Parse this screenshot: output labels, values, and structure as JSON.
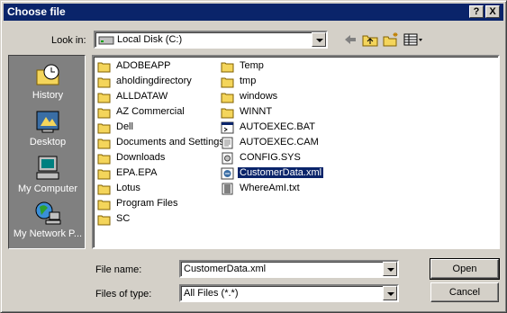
{
  "dialog": {
    "title": "Choose file",
    "help_label": "?",
    "close_label": "X"
  },
  "toolbar": {
    "look_in_label": "Look in:",
    "look_in_value": "Local Disk (C:)",
    "tools": [
      "back-arrow-icon",
      "up-folder-icon",
      "new-folder-icon",
      "view-menu-icon"
    ]
  },
  "places": [
    {
      "label": "History",
      "icon": "history-icon"
    },
    {
      "label": "Desktop",
      "icon": "desktop-icon"
    },
    {
      "label": "My Computer",
      "icon": "my-computer-icon"
    },
    {
      "label": "My Network P...",
      "icon": "network-icon"
    }
  ],
  "files": [
    {
      "name": "ADOBEAPP",
      "type": "folder"
    },
    {
      "name": "aholdingdirectory",
      "type": "folder"
    },
    {
      "name": "ALLDATAW",
      "type": "folder"
    },
    {
      "name": "AZ Commercial",
      "type": "folder"
    },
    {
      "name": "Dell",
      "type": "folder"
    },
    {
      "name": "Documents and Settings",
      "type": "folder"
    },
    {
      "name": "Downloads",
      "type": "folder"
    },
    {
      "name": "EPA.EPA",
      "type": "folder"
    },
    {
      "name": "Lotus",
      "type": "folder"
    },
    {
      "name": "Program Files",
      "type": "folder"
    },
    {
      "name": "SC",
      "type": "folder"
    },
    {
      "name": "Temp",
      "type": "folder"
    },
    {
      "name": "tmp",
      "type": "folder"
    },
    {
      "name": "windows",
      "type": "folder"
    },
    {
      "name": "WINNT",
      "type": "folder"
    },
    {
      "name": "AUTOEXEC.BAT",
      "type": "bat"
    },
    {
      "name": "AUTOEXEC.CAM",
      "type": "doc"
    },
    {
      "name": "CONFIG.SYS",
      "type": "sys"
    },
    {
      "name": "CustomerData.xml",
      "type": "xml",
      "selected": true
    },
    {
      "name": "WhereAmI.txt",
      "type": "txt"
    }
  ],
  "footer": {
    "file_name_label": "File name:",
    "file_name_value": "CustomerData.xml",
    "files_of_type_label": "Files of type:",
    "files_of_type_value": "All Files (*.*)",
    "open_label": "Open",
    "cancel_label": "Cancel"
  },
  "colors": {
    "title_bar": "#0a246a",
    "face": "#d4d0c8",
    "places_bg": "#808080",
    "folder": "#f4d55b"
  }
}
